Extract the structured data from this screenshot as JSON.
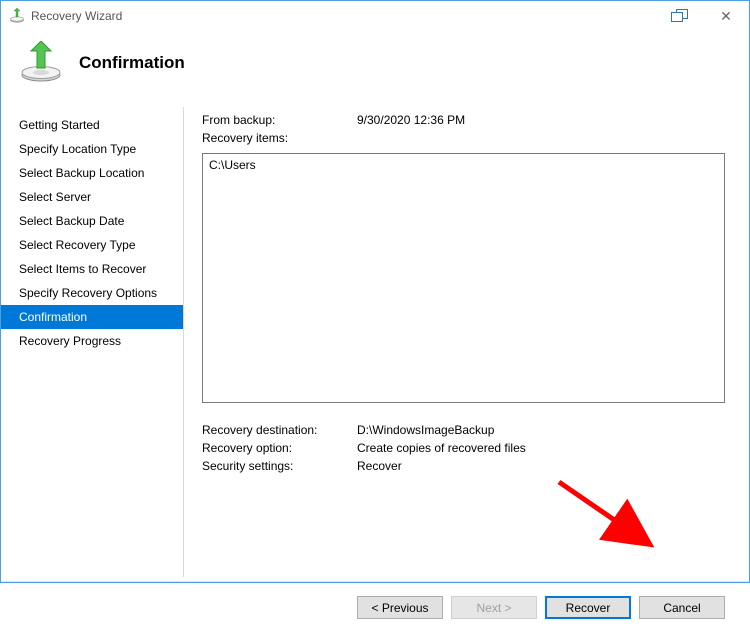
{
  "window": {
    "title": "Recovery Wizard"
  },
  "header": {
    "heading": "Confirmation"
  },
  "sidebar": {
    "steps": [
      "Getting Started",
      "Specify Location Type",
      "Select Backup Location",
      "Select Server",
      "Select Backup Date",
      "Select Recovery Type",
      "Select Items to Recover",
      "Specify Recovery Options",
      "Confirmation",
      "Recovery Progress"
    ],
    "selected_index": 8
  },
  "main": {
    "from_backup_label": "From backup:",
    "from_backup_value": "9/30/2020 12:36 PM",
    "recovery_items_label": "Recovery items:",
    "recovery_items": [
      "C:\\Users"
    ],
    "recovery_destination_label": "Recovery destination:",
    "recovery_destination_value": "D:\\WindowsImageBackup",
    "recovery_option_label": "Recovery option:",
    "recovery_option_value": "Create copies of recovered files",
    "security_settings_label": "Security settings:",
    "security_settings_value": "Recover"
  },
  "buttons": {
    "previous": "< Previous",
    "next": "Next >",
    "recover": "Recover",
    "cancel": "Cancel"
  }
}
